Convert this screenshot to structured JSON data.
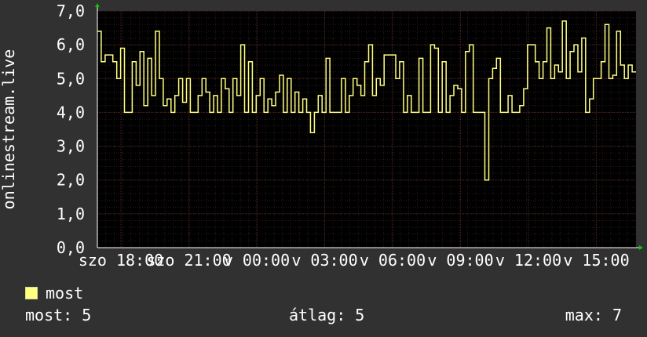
{
  "chart_data": {
    "type": "line",
    "ylabel": "onlinestream.live",
    "ylim": [
      0,
      7
    ],
    "yticks": [
      "0,0",
      "1,0",
      "2,0",
      "3,0",
      "4,0",
      "5,0",
      "6,0",
      "7,0"
    ],
    "xticks": [
      "szo 18:00",
      "szo 21:00",
      "v 00:00",
      "v 03:00",
      "v 06:00",
      "v 09:00",
      "v 12:00",
      "v 15:00"
    ],
    "grid": true,
    "colors": {
      "background": "#313131",
      "plot": "#000000",
      "grid": "#4a2222",
      "line": "#ffff80",
      "axis": "#ffffff",
      "arrow": "#00cc00"
    },
    "series": [
      {
        "name": "most",
        "values": [
          6.4,
          5.5,
          5.7,
          5.7,
          5.5,
          5,
          5.9,
          4,
          4,
          5.5,
          4.8,
          5.8,
          4.2,
          5.6,
          4.5,
          6.4,
          5,
          4.2,
          4.4,
          4,
          4.5,
          5,
          4.3,
          5,
          4,
          4,
          4.5,
          5,
          4.6,
          4,
          4.5,
          4,
          5,
          4.7,
          4,
          5,
          4.5,
          6,
          4,
          5.5,
          4,
          4.5,
          5,
          4,
          4.4,
          4.2,
          4.6,
          5.1,
          4,
          5,
          4,
          4.6,
          4,
          4.4,
          4,
          3.4,
          4,
          4.5,
          4,
          5.6,
          4,
          4,
          4,
          5,
          4,
          4.5,
          5,
          4.8,
          4.5,
          5.5,
          6,
          4.5,
          5,
          4.8,
          5.7,
          5.7,
          5.7,
          5,
          5.5,
          4,
          4.5,
          4,
          4,
          5.6,
          4,
          4,
          6,
          5.9,
          4,
          5.5,
          4,
          4.5,
          4.8,
          4.7,
          4,
          5.8,
          6,
          4,
          4,
          4,
          2,
          5,
          5.3,
          5.6,
          4,
          4,
          4.5,
          4,
          4,
          4.2,
          4.7,
          6,
          6,
          5.5,
          5,
          5.5,
          6.5,
          5,
          5.4,
          5.2,
          6.7,
          5,
          5.8,
          6,
          5.2,
          6.2,
          4,
          4.4,
          5,
          5,
          5.5,
          6.6,
          5,
          5.1,
          6.4,
          5.4,
          5,
          5.4,
          5.2
        ]
      }
    ]
  },
  "legend": [
    {
      "label": "most",
      "color": "#ffff80"
    }
  ],
  "stats": {
    "now": "most: 5",
    "avg": "átlag: 5",
    "max": "max: 7"
  }
}
